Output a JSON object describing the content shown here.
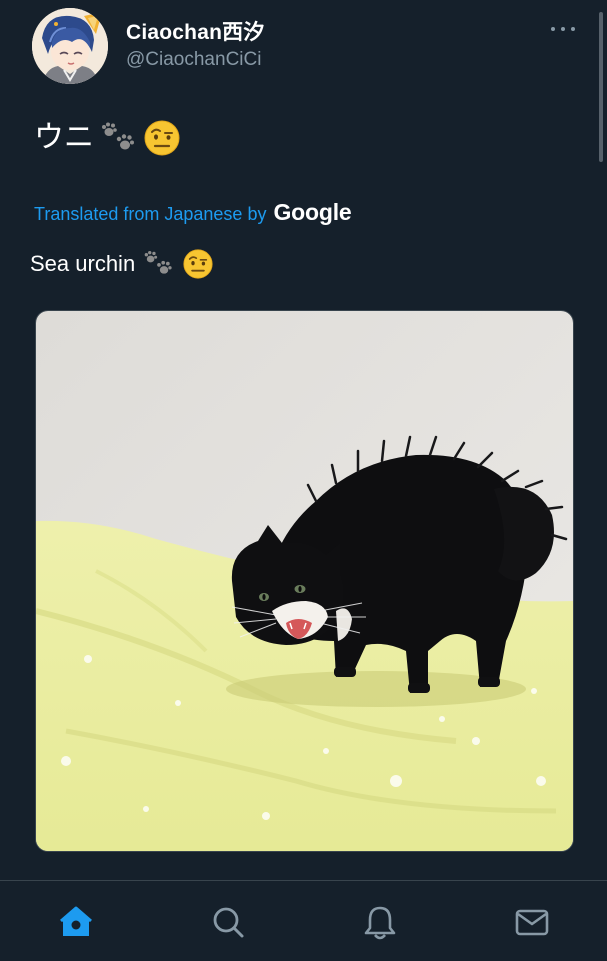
{
  "tweet": {
    "display_name": "Ciaochan西汐",
    "handle": "@CiaochanCiCi",
    "text": "ウニ",
    "text_emojis": [
      "paw-prints-icon",
      "face-with-raised-eyebrow-emoji"
    ],
    "translation_label": "Translated from Japanese by",
    "translation_provider": "Google",
    "translated_text": "Sea urchin",
    "media": {
      "type": "photo",
      "subject": "black-and-white-cat-arched-back",
      "background_color": "#e7e5e2",
      "bedsheet_color": "#eef0a7"
    }
  },
  "nav": {
    "items": [
      {
        "icon": "home-icon",
        "active": true
      },
      {
        "icon": "search-icon",
        "active": false
      },
      {
        "icon": "notifications-icon",
        "active": false
      },
      {
        "icon": "messages-icon",
        "active": false
      }
    ]
  },
  "colors": {
    "background": "#15202b",
    "accent": "#1d9bf0",
    "secondary_text": "#8899a6",
    "border": "#38444d"
  }
}
